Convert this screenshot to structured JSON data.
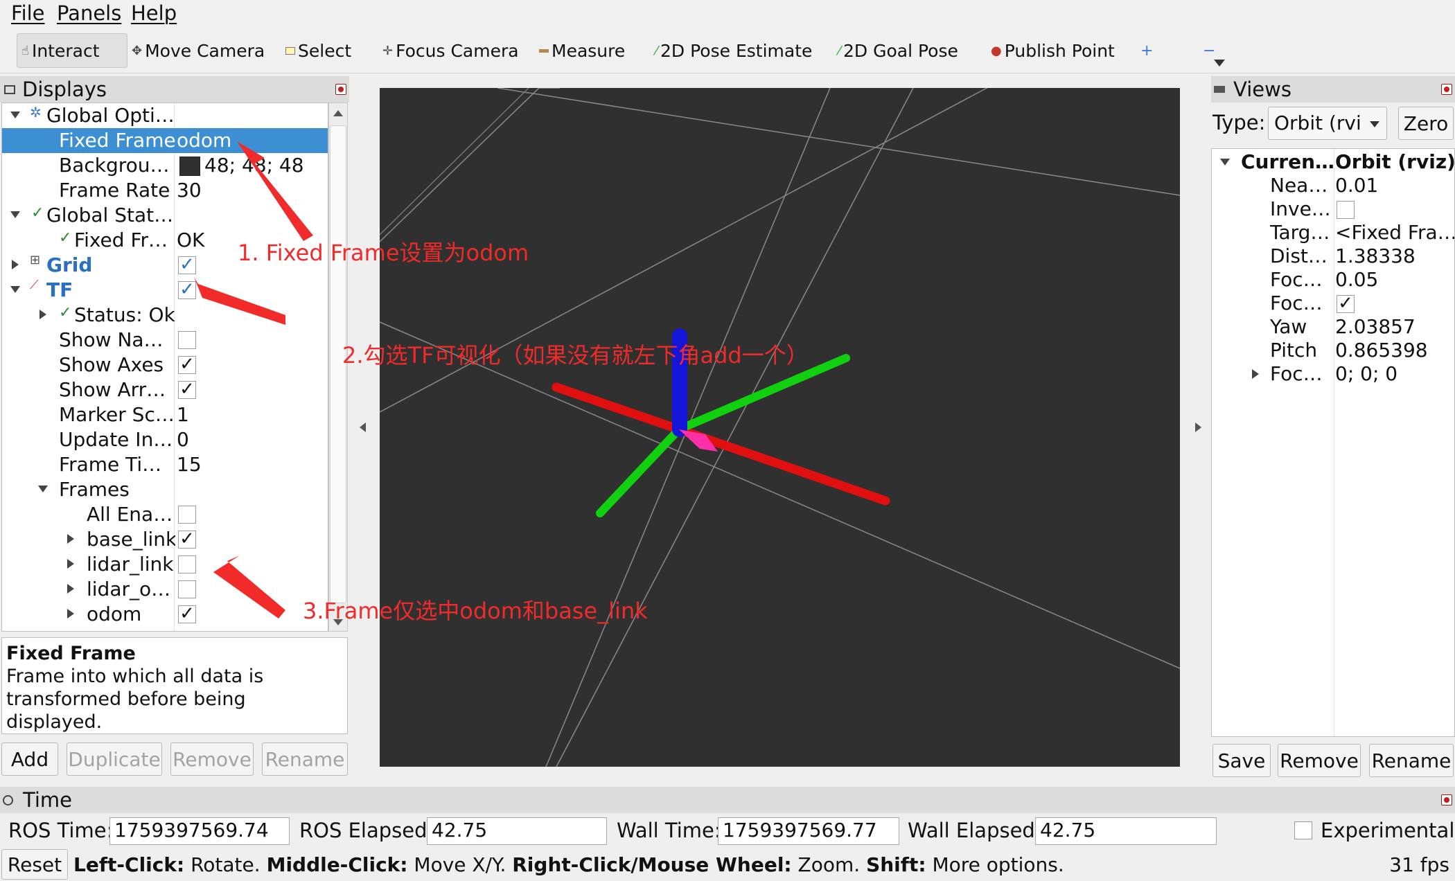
{
  "menu": [
    "File",
    "Panels",
    "Help"
  ],
  "toolbar": {
    "interact": "Interact",
    "move_camera": "Move Camera",
    "select": "Select",
    "focus_camera": "Focus Camera",
    "measure": "Measure",
    "pose_estimate": "2D Pose Estimate",
    "goal_pose": "2D Goal Pose",
    "publish_point": "Publish Point"
  },
  "displays": {
    "title": "Displays",
    "rows": [
      {
        "name": "Global Opti…",
        "value": ""
      },
      {
        "name": "Fixed Frame",
        "value": "odom"
      },
      {
        "name": "Backgrou…",
        "value": "48; 48; 48"
      },
      {
        "name": "Frame Rate",
        "value": "30"
      },
      {
        "name": "Global Stat…",
        "value": ""
      },
      {
        "name": "Fixed Fr…",
        "value": "OK"
      },
      {
        "name": "Grid",
        "value": ""
      },
      {
        "name": "TF",
        "value": ""
      },
      {
        "name": "Status: Ok",
        "value": ""
      },
      {
        "name": "Show Na…",
        "value": ""
      },
      {
        "name": "Show Axes",
        "value": ""
      },
      {
        "name": "Show Arr…",
        "value": ""
      },
      {
        "name": "Marker Sc…",
        "value": "1"
      },
      {
        "name": "Update In…",
        "value": "0"
      },
      {
        "name": "Frame Ti…",
        "value": "15"
      },
      {
        "name": "Frames",
        "value": ""
      },
      {
        "name": "All Ena…",
        "value": ""
      },
      {
        "name": "base_link",
        "value": ""
      },
      {
        "name": "lidar_link",
        "value": ""
      },
      {
        "name": "lidar_o…",
        "value": ""
      },
      {
        "name": "odom",
        "value": ""
      }
    ]
  },
  "description": {
    "title": "Fixed Frame",
    "line1": "Frame into which all data is",
    "line2": "transformed before being displayed."
  },
  "displays_buttons": {
    "add": "Add",
    "duplicate": "Duplicate",
    "remove": "Remove",
    "rename": "Rename"
  },
  "views": {
    "title": "Views",
    "type_label": "Type:",
    "type_value": "Orbit (rviz)",
    "zero": "Zero",
    "header_name": "Curren…",
    "header_value": "Orbit (rviz)",
    "rows": [
      {
        "name": "Nea…",
        "value": "0.01"
      },
      {
        "name": "Inve…",
        "value": ""
      },
      {
        "name": "Targ…",
        "value": "<Fixed Fra…"
      },
      {
        "name": "Dist…",
        "value": "1.38338"
      },
      {
        "name": "Foc…",
        "value": "0.05"
      },
      {
        "name": "Foc…",
        "value": ""
      },
      {
        "name": "Yaw",
        "value": "2.03857"
      },
      {
        "name": "Pitch",
        "value": "0.865398"
      },
      {
        "name": "Foc…",
        "value": "0; 0; 0"
      }
    ],
    "save": "Save",
    "remove": "Remove",
    "rename": "Rename"
  },
  "time": {
    "title": "Time",
    "ros_time_label": "ROS Time:",
    "ros_time": "1759397569.74",
    "ros_elapsed_label": "ROS Elapsed:",
    "ros_elapsed": "42.75",
    "wall_time_label": "Wall Time:",
    "wall_time": "1759397569.77",
    "wall_elapsed_label": "Wall Elapsed:",
    "wall_elapsed": "42.75",
    "experimental": "Experimental"
  },
  "statusbar": {
    "reset": "Reset",
    "left_click": "Left-Click:",
    "left_click_action": "Rotate.",
    "middle_click": "Middle-Click:",
    "middle_click_action": "Move X/Y.",
    "right_click": "Right-Click/Mouse Wheel:",
    "right_click_action": "Zoom.",
    "shift": "Shift:",
    "shift_action": "More options.",
    "fps": "31 fps"
  },
  "annotations": {
    "a1": "1. Fixed Frame设置为odom",
    "a2": "2.勾选TF可视化（如果没有就左下角add一个）",
    "a3": "3.Frame仅选中odom和base_link"
  },
  "colors": {
    "viewport_bg": "#303030",
    "selection": "#3c8fd2",
    "annotation": "#f12a2a",
    "link_blue": "#2a6fc2"
  }
}
